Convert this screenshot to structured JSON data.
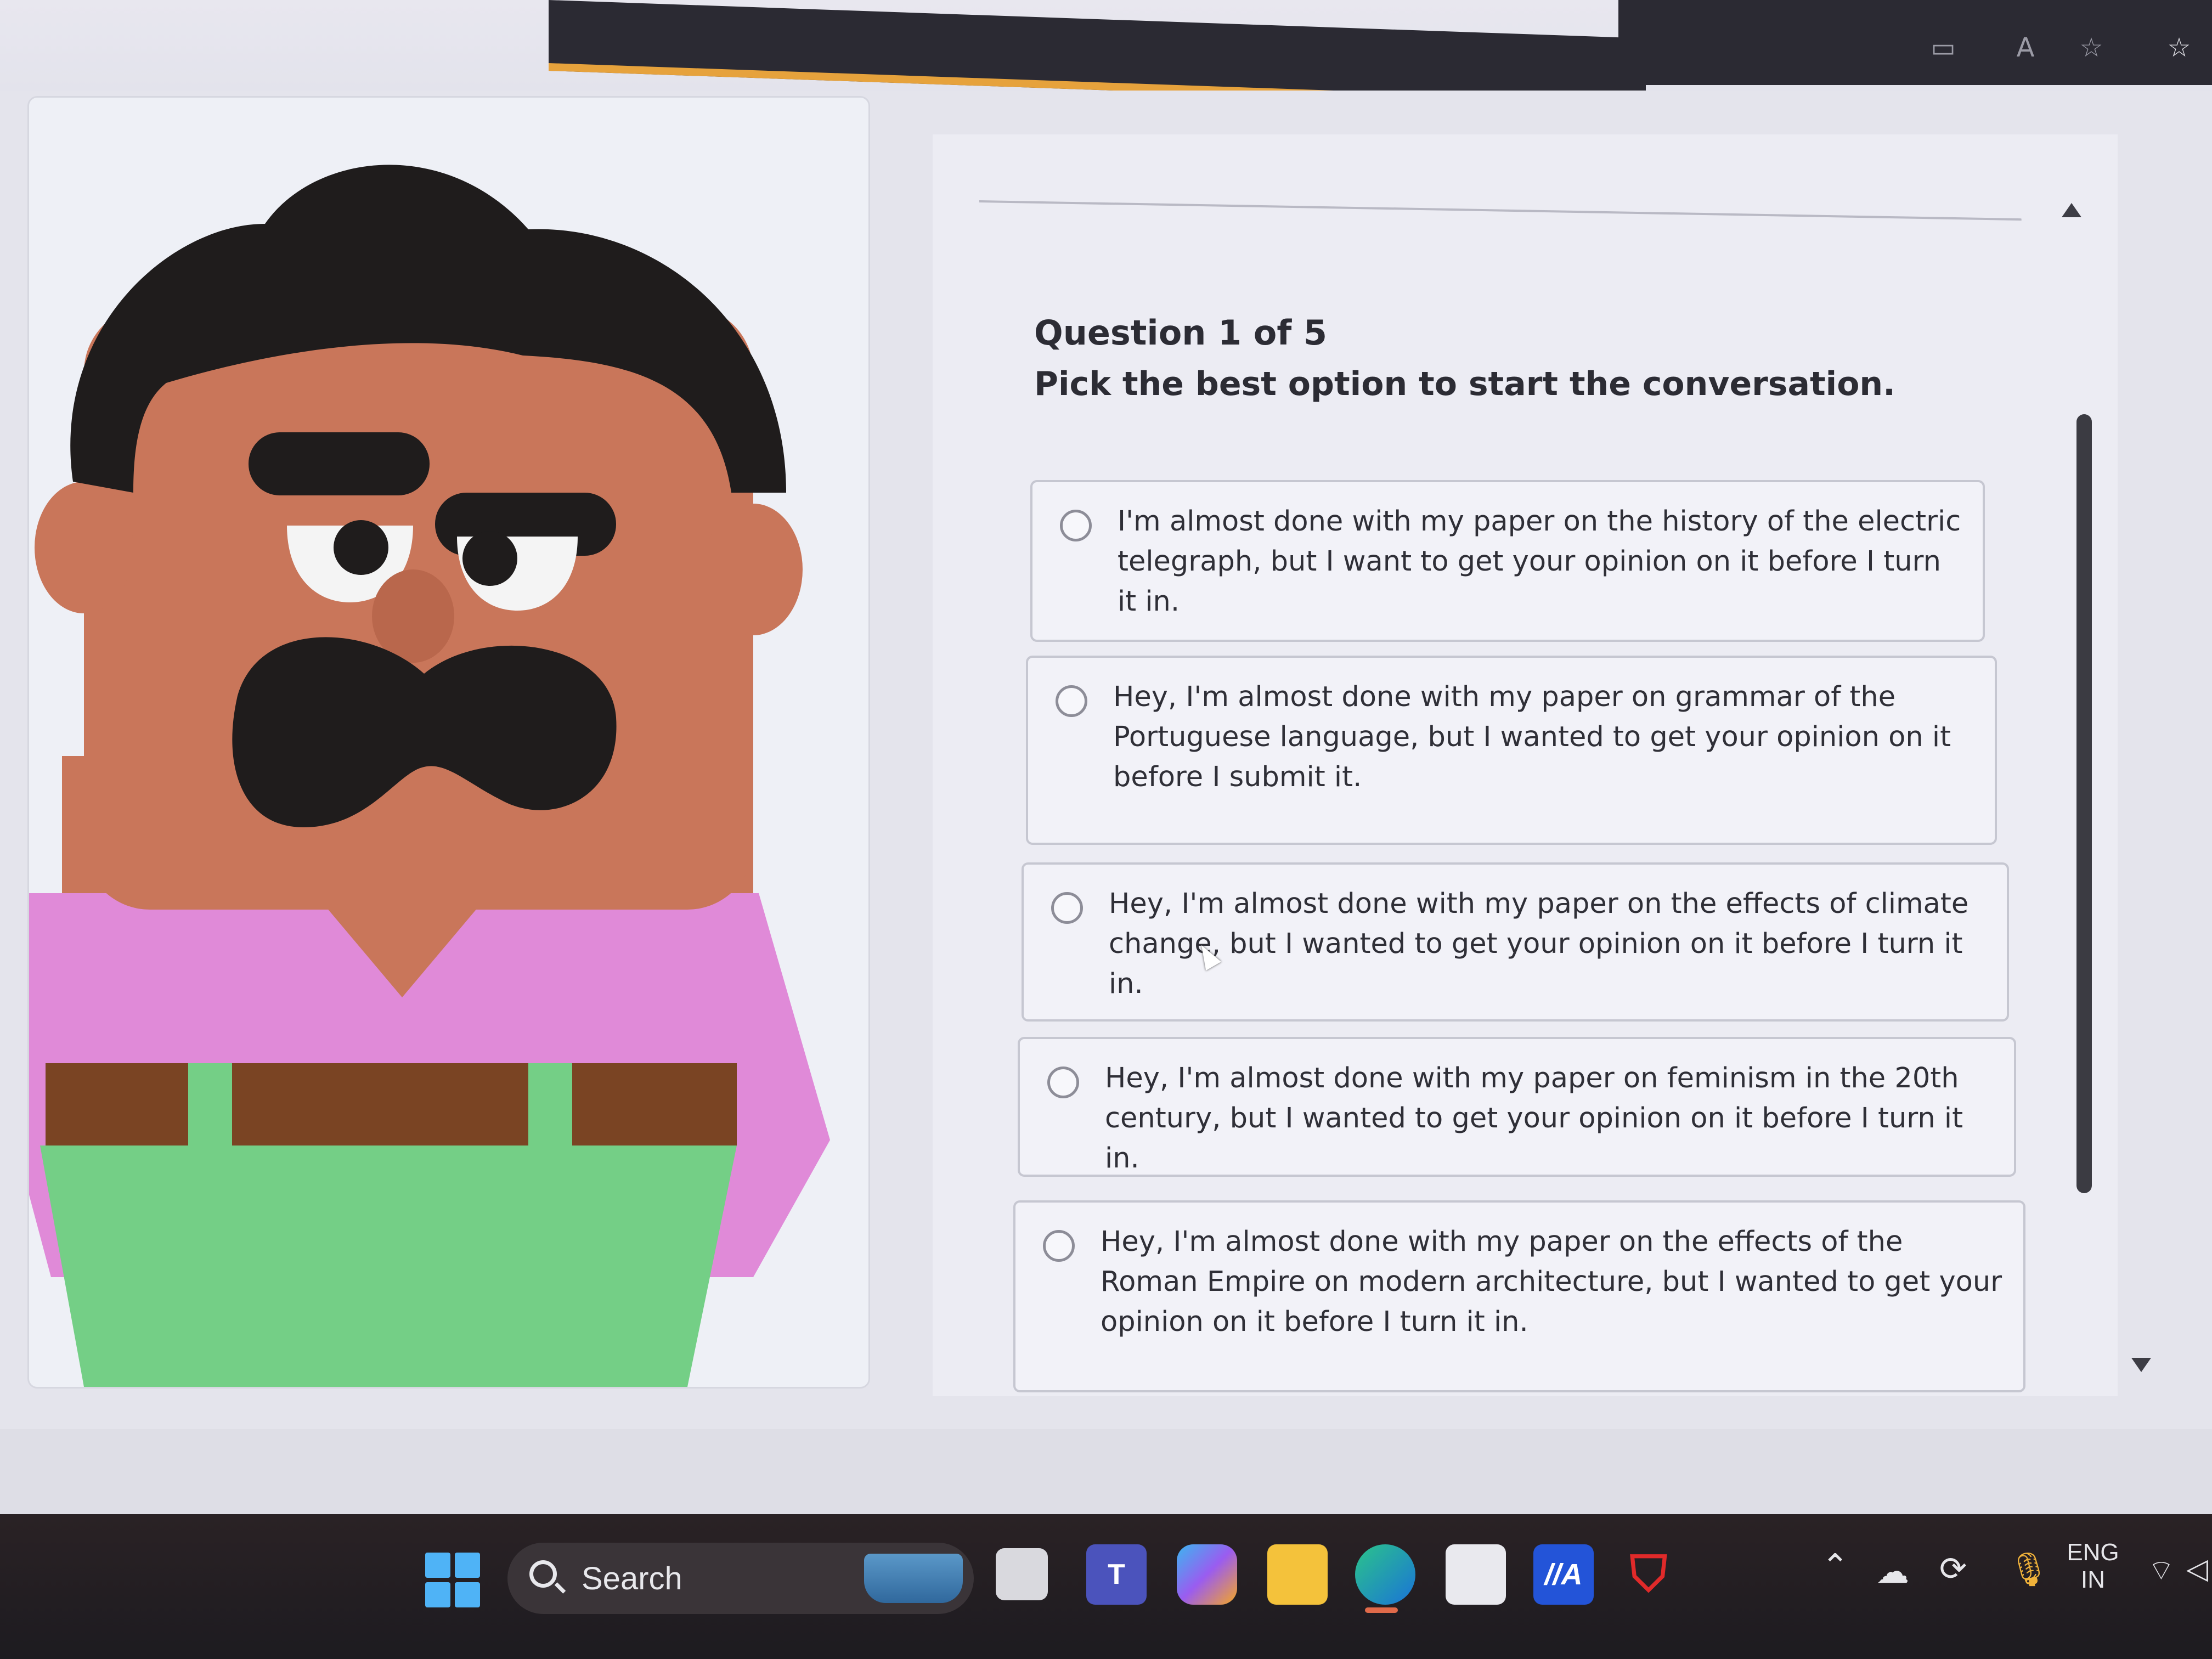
{
  "browser": {
    "toolbar_icons": [
      "video-icon",
      "read-aloud-icon",
      "favorite-star-icon",
      "favorites-bar-icon"
    ]
  },
  "quiz": {
    "question_number": "Question 1 of 5",
    "prompt": "Pick the best option to start the conversation.",
    "options": [
      {
        "label": "I'm almost done with my paper on the history of the electric telegraph, but I want to get your opinion on it before I turn it in.",
        "selected": false
      },
      {
        "label": "Hey, I'm almost done with my paper on grammar of the Portuguese language, but I wanted to get your opinion on it before I submit it.",
        "selected": false
      },
      {
        "label": "Hey, I'm almost done with my paper on the effects of climate change, but I wanted to get your opinion on it before I turn it in.",
        "selected": false
      },
      {
        "label": "Hey, I'm almost done with my paper on feminism in the 20th century, but I wanted to get your opinion on it before I turn it in.",
        "selected": false
      },
      {
        "label": "Hey, I'm almost done with my paper on the effects of the Roman Empire on modern architecture, but I wanted to get your opinion on it before I turn it in.",
        "selected": false
      }
    ]
  },
  "character": {
    "name": "cartoon-character-illustration"
  },
  "taskbar": {
    "search_label": "Search",
    "apps": [
      "windows-start-icon",
      "task-view-icon",
      "teams-icon",
      "copilot-icon",
      "file-explorer-icon",
      "edge-icon",
      "store-icon",
      "mcafee-app-icon",
      "mcafee-shield-icon"
    ],
    "active_app": "edge-icon",
    "tray": {
      "language_top": "ENG",
      "language_bottom": "IN",
      "icons": [
        "chevron-up-icon",
        "onedrive-icon",
        "sync-icon",
        "microphone-icon",
        "wifi-icon",
        "speaker-icon"
      ]
    }
  },
  "colors": {
    "option_border": "#c6c7d1",
    "character_skin": "#c9765a",
    "character_hair": "#1f1c1c",
    "character_shirt": "#e08ad8",
    "character_pants": "#74cf86",
    "character_belt": "#7a4423"
  }
}
